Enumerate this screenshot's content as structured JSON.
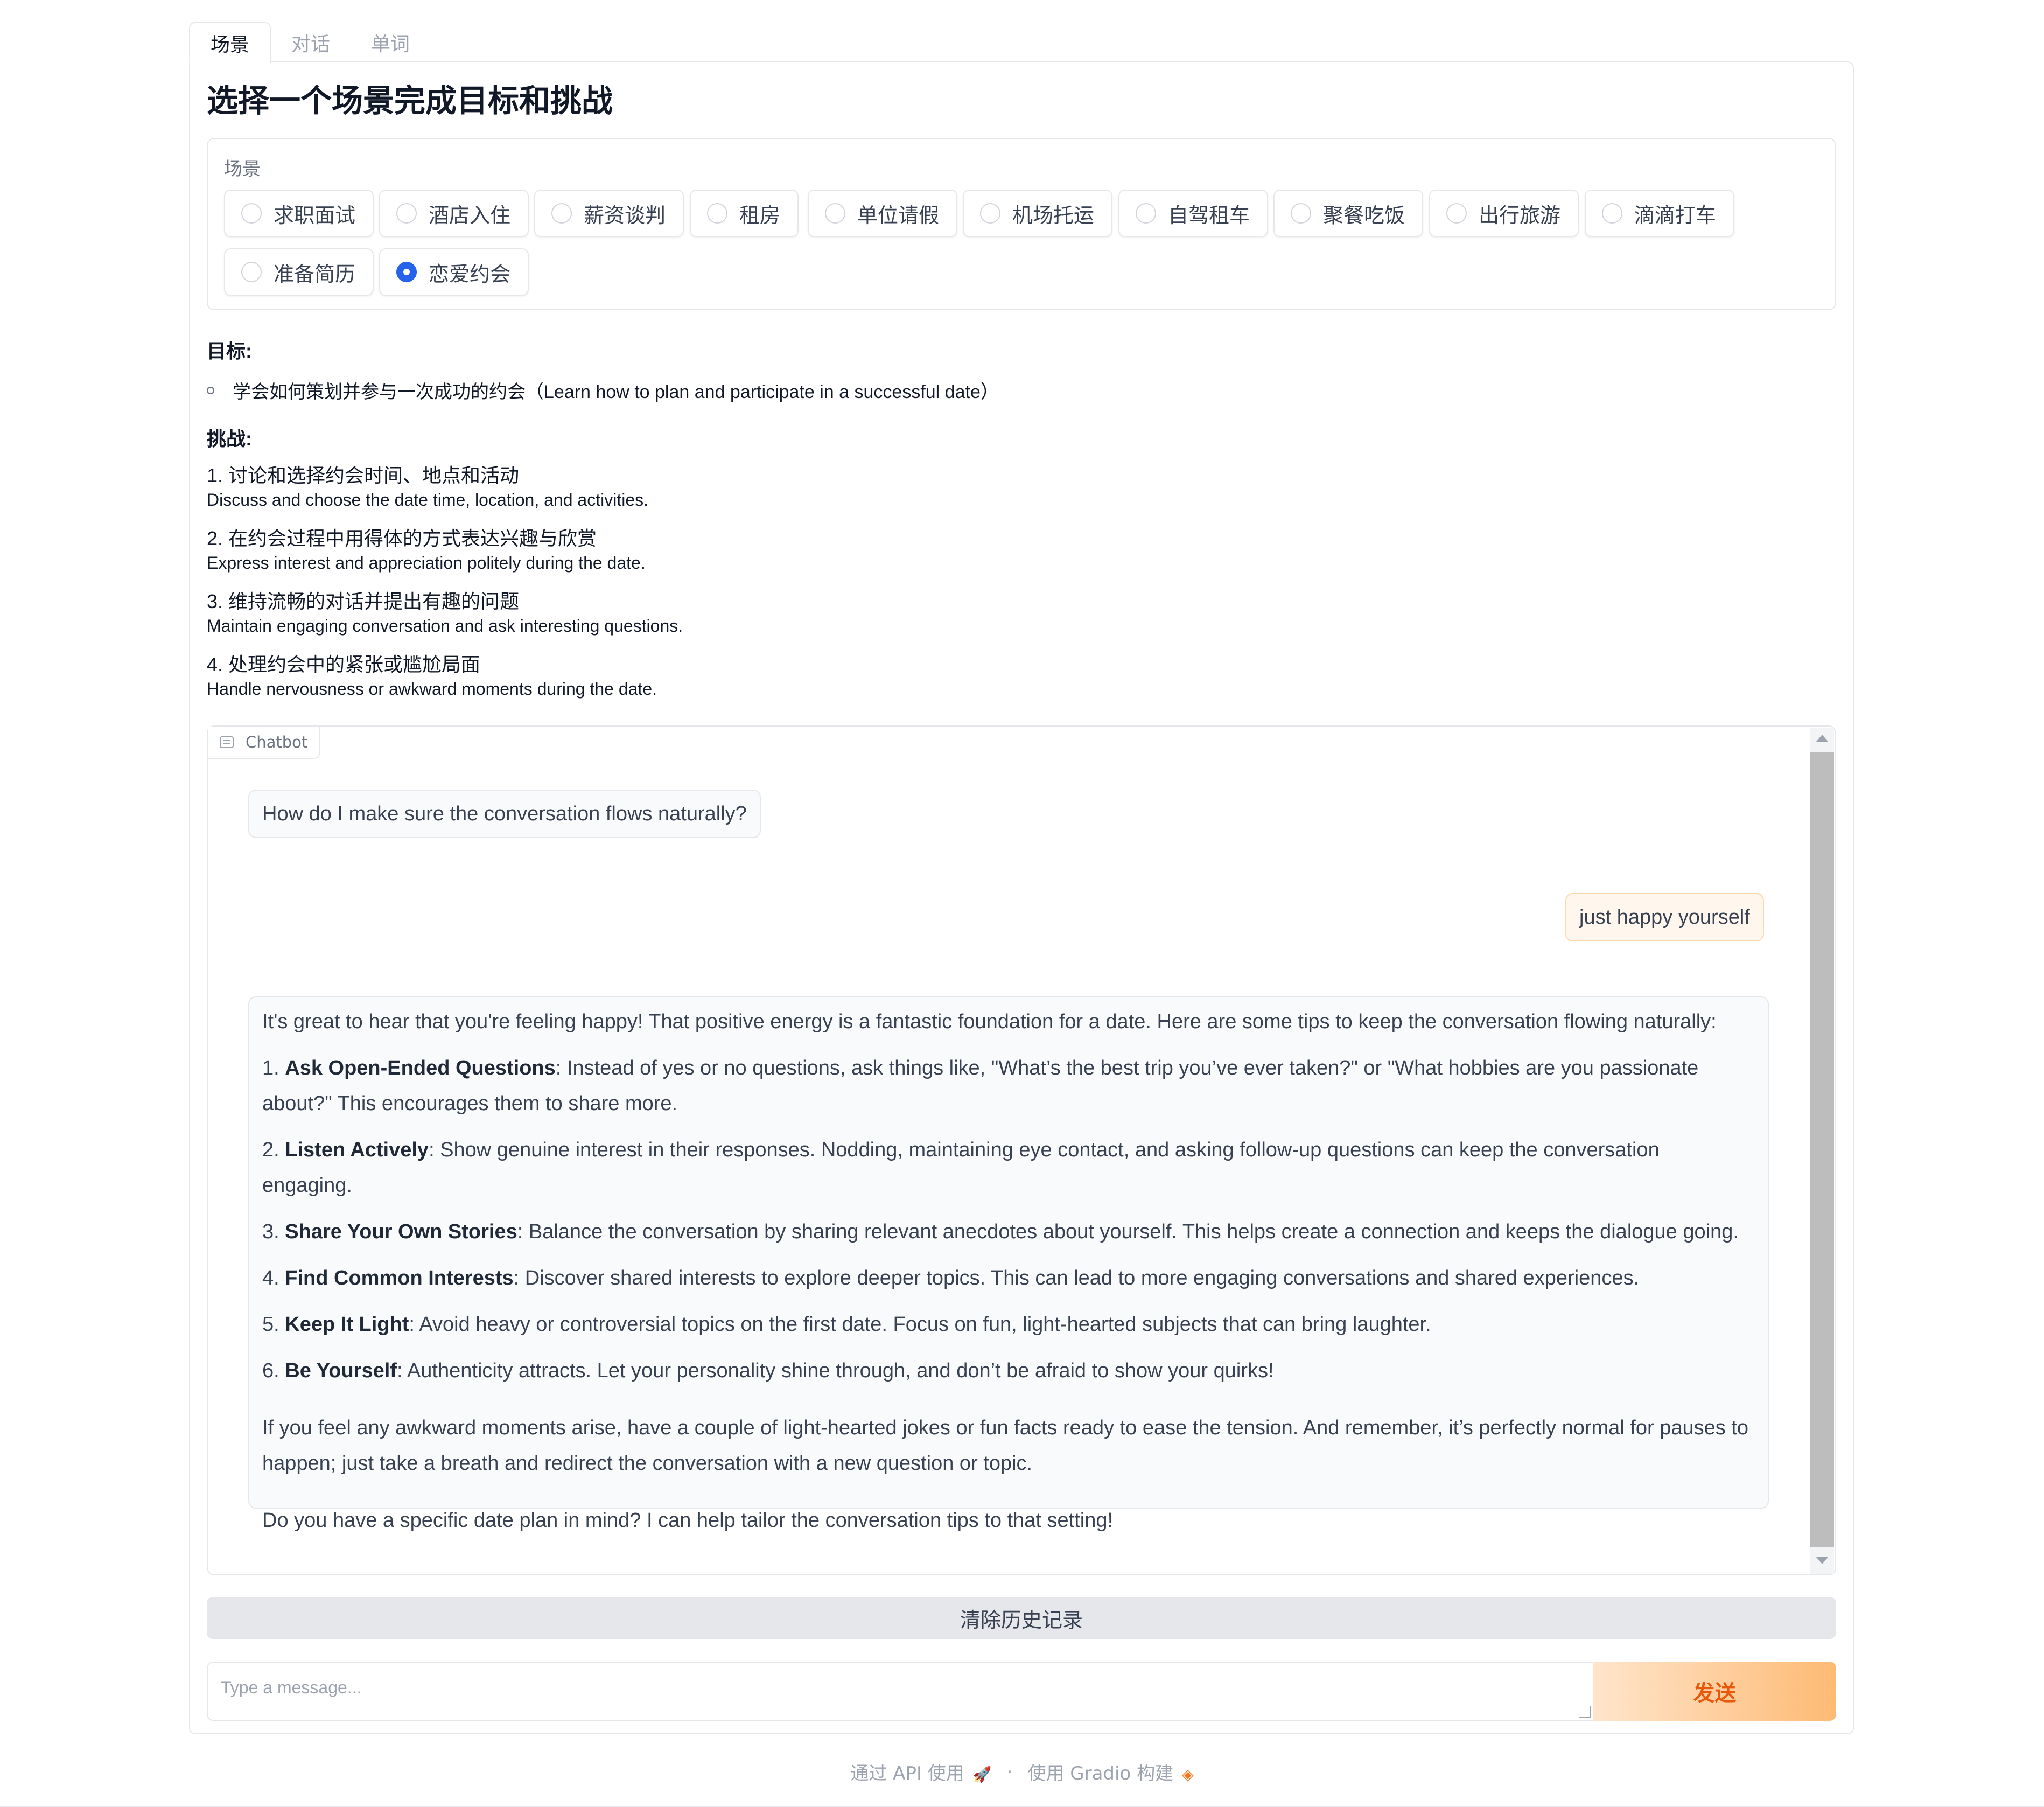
{
  "tabs": [
    "场景",
    "对话",
    "单词"
  ],
  "page_title": "选择一个场景完成目标和挑战",
  "scene": {
    "label": "场景",
    "options": [
      "求职面试",
      "酒店入住",
      "薪资谈判",
      "租房",
      "单位请假",
      "机场托运",
      "自驾租车",
      "聚餐吃饭",
      "出行旅游",
      "滴滴打车",
      "准备简历",
      "恋爱约会"
    ],
    "selected": "恋爱约会"
  },
  "goal": {
    "heading": "目标:",
    "items": [
      "学会如何策划并参与一次成功的约会（Learn how to plan and participate in a successful date）"
    ]
  },
  "challenge": {
    "heading": "挑战:",
    "items": [
      {
        "cn": "1. 讨论和选择约会时间、地点和活动",
        "en": "Discuss and choose the date time, location, and activities."
      },
      {
        "cn": "2. 在约会过程中用得体的方式表达兴趣与欣赏",
        "en": "Express interest and appreciation politely during the date."
      },
      {
        "cn": "3. 维持流畅的对话并提出有趣的问题",
        "en": "Maintain engaging conversation and ask interesting questions."
      },
      {
        "cn": "4. 处理约会中的紧张或尴尬局面",
        "en": "Handle nervousness or awkward moments during the date."
      }
    ]
  },
  "chatbot": {
    "label": "Chatbot",
    "messages": {
      "m1": "How do I make sure the conversation flows naturally?",
      "m2": "just happy yourself",
      "m3": {
        "intro": "It's great to hear that you're feeling happy! That positive energy is a fantastic foundation for a date. Here are some tips to keep the conversation flowing naturally:",
        "tips": [
          {
            "num": "1.",
            "title": "Ask Open-Ended Questions",
            "text": ": Instead of yes or no questions, ask things like, \"What’s the best trip you’ve ever taken?\" or \"What hobbies are you passionate about?\" This encourages them to share more."
          },
          {
            "num": "2.",
            "title": "Listen Actively",
            "text": ": Show genuine interest in their responses. Nodding, maintaining eye contact, and asking follow-up questions can keep the conversation engaging."
          },
          {
            "num": "3.",
            "title": "Share Your Own Stories",
            "text": ": Balance the conversation by sharing relevant anecdotes about yourself. This helps create a connection and keeps the dialogue going."
          },
          {
            "num": "4.",
            "title": "Find Common Interests",
            "text": ": Discover shared interests to explore deeper topics. This can lead to more engaging conversations and shared experiences."
          },
          {
            "num": "5.",
            "title": "Keep It Light",
            "text": ": Avoid heavy or controversial topics on the first date. Focus on fun, light-hearted subjects that can bring laughter."
          },
          {
            "num": "6.",
            "title": "Be Yourself",
            "text": ": Authenticity attracts. Let your personality shine through, and don’t be afraid to show your quirks!"
          }
        ],
        "para1": "If you feel any awkward moments arise, have a couple of light-hearted jokes or fun facts ready to ease the tension. And remember, it’s perfectly normal for pauses to happen; just take a breath and redirect the conversation with a new question or topic.",
        "para2": "Do you have a specific date plan in mind? I can help tailor the conversation tips to that setting!"
      }
    }
  },
  "clear_label": "清除历史记录",
  "input": {
    "placeholder": "Type a message...",
    "value": ""
  },
  "send_label": "发送",
  "footer": {
    "api_label": "通过 API 使用",
    "api_icon": "rocket-icon",
    "separator": "·",
    "built_label": "使用 Gradio 构建",
    "built_icon": "gradio-logo-icon"
  },
  "colors": {
    "accent_blue": "#2563eb",
    "send_text": "#ea580c",
    "send_gradient_end": "#fdba74",
    "user_bubble": "#fff7ed"
  }
}
